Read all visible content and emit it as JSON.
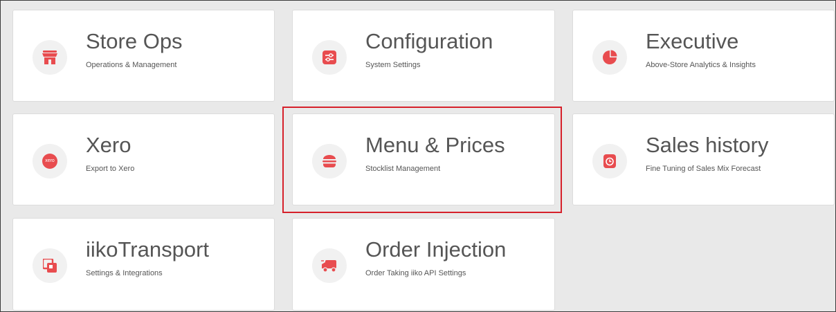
{
  "colors": {
    "accent": "#e84c4f",
    "highlight": "#d6202a",
    "background": "#e9e9e9",
    "tile": "#ffffff",
    "text": "#555555"
  },
  "tiles": [
    {
      "title": "Store Ops",
      "subtitle": "Operations & Management",
      "icon": "store-icon"
    },
    {
      "title": "Configuration",
      "subtitle": "System Settings",
      "icon": "sliders-icon"
    },
    {
      "title": "Executive",
      "subtitle": "Above-Store Analytics & Insights",
      "icon": "pie-chart-icon"
    },
    {
      "title": "Xero",
      "subtitle": "Export to Xero",
      "icon": "xero-logo-icon",
      "icon_text": "xero"
    },
    {
      "title": "Menu & Prices",
      "subtitle": "Stocklist Management",
      "icon": "burger-icon"
    },
    {
      "title": "Sales history",
      "subtitle": "Fine Tuning of Sales Mix Forecast",
      "icon": "clock-icon"
    },
    {
      "title": "iikoTransport",
      "subtitle": "Settings & Integrations",
      "icon": "squares-icon"
    },
    {
      "title": "Order Injection",
      "subtitle": "Order Taking iiko API Settings",
      "icon": "delivery-truck-icon"
    }
  ]
}
